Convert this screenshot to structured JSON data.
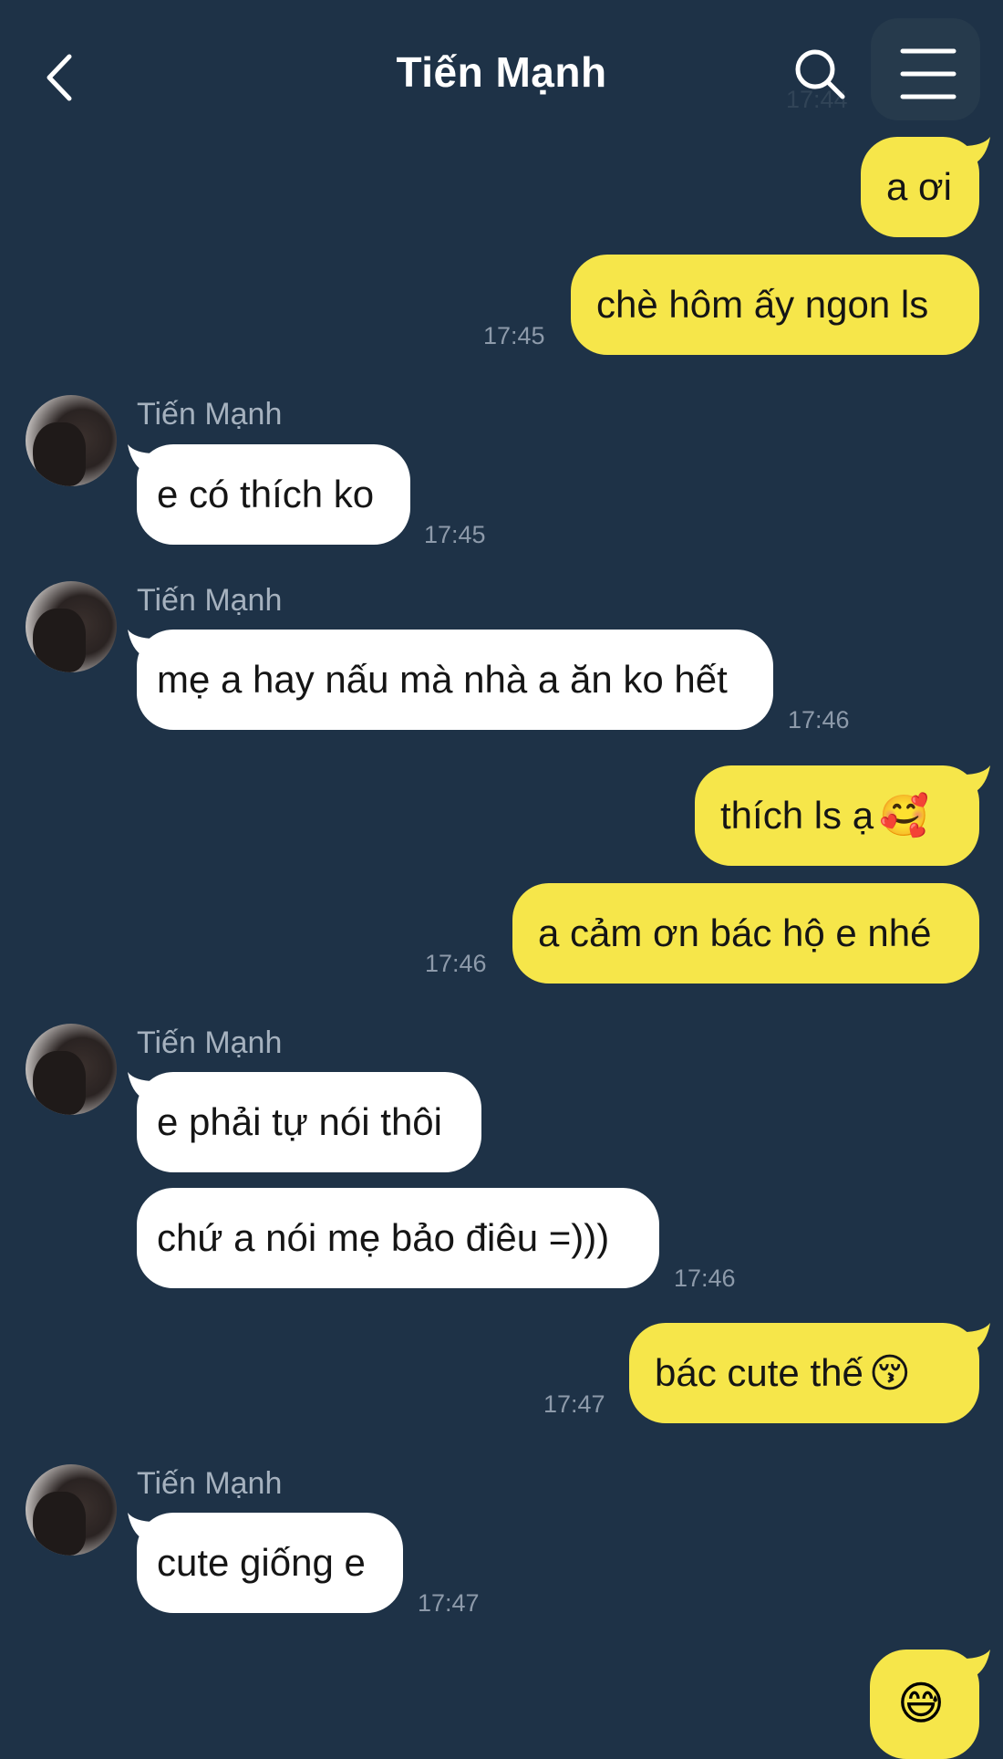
{
  "header": {
    "title": "Tiến Mạnh",
    "back_icon": "chevron-left-icon",
    "search_icon": "search-icon",
    "menu_icon": "hamburger-menu-icon",
    "faded_time": "17:44"
  },
  "colors": {
    "background": "#1e3247",
    "outgoing_bubble": "#f6e64a",
    "incoming_bubble": "#ffffff",
    "timestamp": "#8d9aaa",
    "sender_name": "#a5b1be"
  },
  "messages": [
    {
      "dir": "out",
      "text": "a ơi"
    },
    {
      "dir": "out",
      "text": "chè hôm ấy ngon ls",
      "time": "17:45"
    },
    {
      "dir": "in",
      "sender": "Tiến Mạnh",
      "text": "e có thích ko",
      "time": "17:45"
    },
    {
      "dir": "in",
      "sender": "Tiến Mạnh",
      "text": "mẹ a hay nấu mà nhà a ăn ko hết",
      "time": "17:46"
    },
    {
      "dir": "out",
      "text": "thích ls ạ",
      "emoji": "🥰"
    },
    {
      "dir": "out",
      "text": "a cảm ơn bác hộ e nhé",
      "time": "17:46"
    },
    {
      "dir": "in",
      "sender": "Tiến Mạnh",
      "text": "e phải tự nói thôi"
    },
    {
      "dir": "in",
      "text": "chứ a nói mẹ bảo điêu =)))",
      "time": "17:46"
    },
    {
      "dir": "out",
      "text": "bác cute thế",
      "emoji": "😚",
      "time": "17:47"
    },
    {
      "dir": "in",
      "sender": "Tiến Mạnh",
      "text": "cute giống e",
      "time": "17:47"
    },
    {
      "dir": "out",
      "emoji": "😅"
    }
  ]
}
